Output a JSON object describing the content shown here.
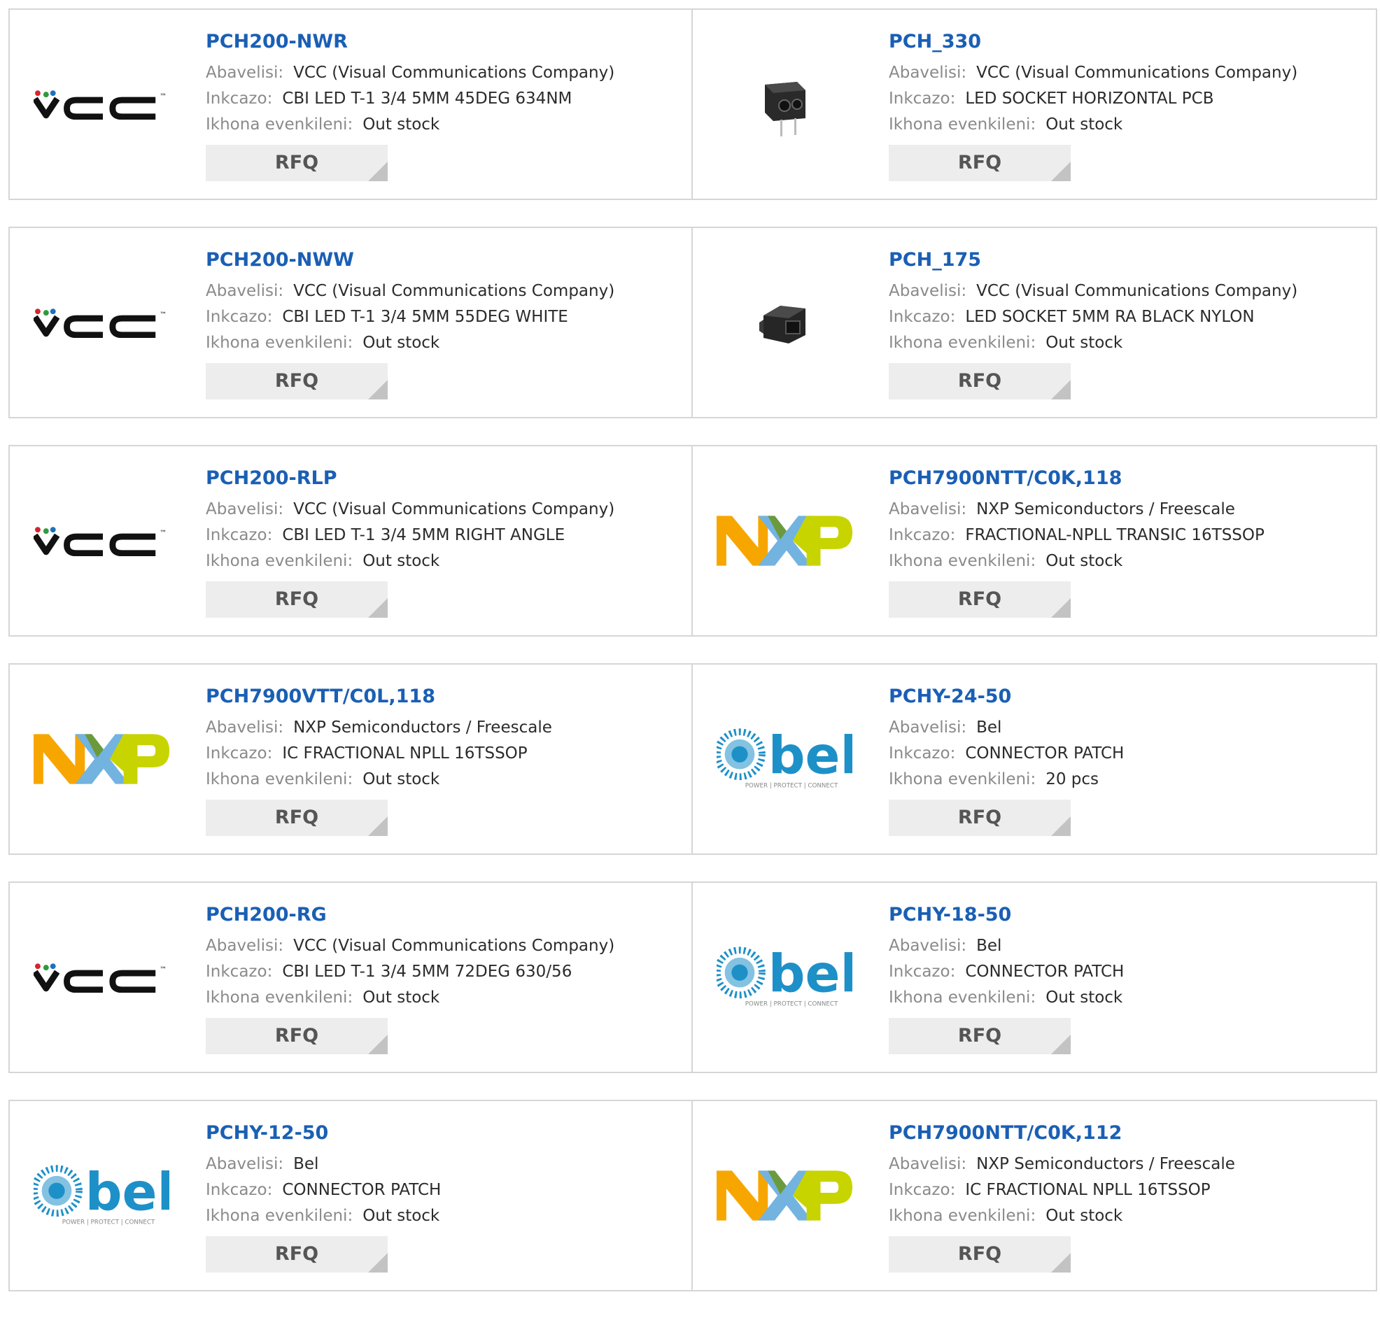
{
  "labels": {
    "manufacturer": "Abavelisi:",
    "description": "Inkcazo:",
    "stock": "Ikhona evenkileni:",
    "rfq": "RFQ"
  },
  "logos": {
    "vcc": {
      "text": "VCC",
      "tm": "™"
    },
    "nxp": {
      "text": "NXP"
    },
    "bel": {
      "text": "bel",
      "tagline": "POWER | PROTECT | CONNECT"
    }
  },
  "colors": {
    "title": "#1a5fb4",
    "button_bg": "#ededed",
    "nxp_orange": "#f7a600",
    "nxp_blue": "#73b3e0",
    "nxp_green": "#c8d400",
    "bel_blue": "#1e90c8"
  },
  "products": [
    {
      "part": "PCH200-NWR",
      "manufacturer": "VCC (Visual Communications Company)",
      "description": "CBI LED T-1 3/4 5MM 45DEG 634NM",
      "stock": "Out stock",
      "logo": "vcc-logo"
    },
    {
      "part": "PCH_330",
      "manufacturer": "VCC (Visual Communications Company)",
      "description": "LED SOCKET HORIZONTAL PCB",
      "stock": "Out stock",
      "logo": "led-socket-image"
    },
    {
      "part": "PCH200-NWW",
      "manufacturer": "VCC (Visual Communications Company)",
      "description": "CBI LED T-1 3/4 5MM 55DEG WHITE",
      "stock": "Out stock",
      "logo": "vcc-logo"
    },
    {
      "part": "PCH_175",
      "manufacturer": "VCC (Visual Communications Company)",
      "description": "LED SOCKET 5MM RA BLACK NYLON",
      "stock": "Out stock",
      "logo": "led-socket-ra-image"
    },
    {
      "part": "PCH200-RLP",
      "manufacturer": "VCC (Visual Communications Company)",
      "description": "CBI LED T-1 3/4 5MM RIGHT ANGLE",
      "stock": "Out stock",
      "logo": "vcc-logo"
    },
    {
      "part": "PCH7900NTT/C0K,118",
      "manufacturer": "NXP Semiconductors / Freescale",
      "description": "FRACTIONAL-NPLL TRANSIC 16TSSOP",
      "stock": "Out stock",
      "logo": "nxp-logo"
    },
    {
      "part": "PCH7900VTT/C0L,118",
      "manufacturer": "NXP Semiconductors / Freescale",
      "description": "IC FRACTIONAL NPLL 16TSSOP",
      "stock": "Out stock",
      "logo": "nxp-logo"
    },
    {
      "part": "PCHY-24-50",
      "manufacturer": "Bel",
      "description": "CONNECTOR PATCH",
      "stock": "20 pcs",
      "logo": "bel-logo"
    },
    {
      "part": "PCH200-RG",
      "manufacturer": "VCC (Visual Communications Company)",
      "description": "CBI LED T-1 3/4 5MM 72DEG 630/56",
      "stock": "Out stock",
      "logo": "vcc-logo"
    },
    {
      "part": "PCHY-18-50",
      "manufacturer": "Bel",
      "description": "CONNECTOR PATCH",
      "stock": "Out stock",
      "logo": "bel-logo"
    },
    {
      "part": "PCHY-12-50",
      "manufacturer": "Bel",
      "description": "CONNECTOR PATCH",
      "stock": "Out stock",
      "logo": "bel-logo"
    },
    {
      "part": "PCH7900NTT/C0K,112",
      "manufacturer": "NXP Semiconductors / Freescale",
      "description": "IC FRACTIONAL NPLL 16TSSOP",
      "stock": "Out stock",
      "logo": "nxp-logo"
    }
  ]
}
